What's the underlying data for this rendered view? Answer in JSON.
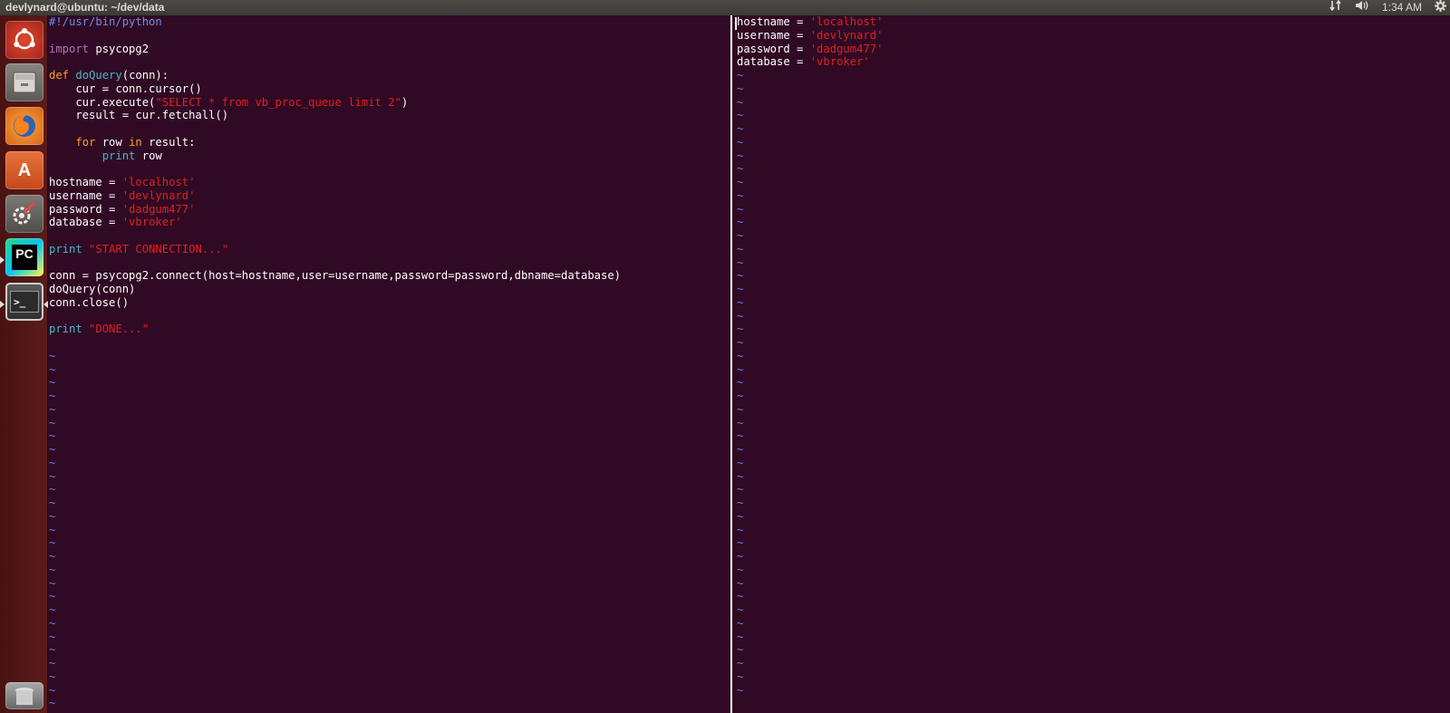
{
  "topbar": {
    "title": "devlynard@ubuntu: ~/dev/data",
    "time": "1:34 AM",
    "icons": [
      "network-icon",
      "volume-icon",
      "settings-gear-icon"
    ]
  },
  "launcher": {
    "items": [
      {
        "name": "ubuntu-dash",
        "label": ""
      },
      {
        "name": "files",
        "label": ""
      },
      {
        "name": "firefox",
        "label": ""
      },
      {
        "name": "software-center",
        "label": "A"
      },
      {
        "name": "system-settings",
        "label": ""
      },
      {
        "name": "pycharm",
        "label": "PC"
      },
      {
        "name": "terminal",
        "label": ">_"
      },
      {
        "name": "trash",
        "label": ""
      }
    ]
  },
  "editor_left": {
    "lines": [
      {
        "t": "comment",
        "text": "#!/usr/bin/python"
      },
      {
        "t": "plain",
        "text": ""
      },
      {
        "t": "import",
        "kw": "import",
        "rest": " psycopg2"
      },
      {
        "t": "plain",
        "text": ""
      },
      {
        "t": "def",
        "kw": "def",
        "fn": "doQuery",
        "rest": "(conn):"
      },
      {
        "t": "plain",
        "text": "    cur = conn.cursor()"
      },
      {
        "t": "strcall",
        "pre": "    cur.execute(",
        "str": "\"SELECT * from vb_proc_queue limit 2\"",
        "post": ")"
      },
      {
        "t": "plain",
        "text": "    result = cur.fetchall()"
      },
      {
        "t": "plain",
        "text": ""
      },
      {
        "t": "for",
        "pre": "    ",
        "kw": "for",
        "mid": " row ",
        "kw2": "in",
        "rest": " result:"
      },
      {
        "t": "printvar",
        "pre": "        ",
        "kw": "print",
        "rest": " row"
      },
      {
        "t": "plain",
        "text": ""
      },
      {
        "t": "assign",
        "name": "hostname",
        "str": "'localhost'"
      },
      {
        "t": "assign",
        "name": "username",
        "str": "'devlynard'"
      },
      {
        "t": "assign",
        "name": "password",
        "str": "'dadgum477'"
      },
      {
        "t": "assign",
        "name": "database",
        "str": "'vbroker'"
      },
      {
        "t": "plain",
        "text": ""
      },
      {
        "t": "printstr",
        "kw": "print",
        "str": "\"START CONNECTION...\""
      },
      {
        "t": "plain",
        "text": ""
      },
      {
        "t": "plain",
        "text": "conn = psycopg2.connect(host=hostname,user=username,password=password,dbname=database)"
      },
      {
        "t": "plain",
        "text": "doQuery(conn)"
      },
      {
        "t": "plain",
        "text": "conn.close()"
      },
      {
        "t": "plain",
        "text": ""
      },
      {
        "t": "printstr",
        "kw": "print",
        "str": "\"DONE...\""
      },
      {
        "t": "plain",
        "text": ""
      }
    ],
    "tilde_count": 27,
    "tilde_char": "~"
  },
  "editor_right": {
    "lines": [
      {
        "t": "assign",
        "name": "hostname",
        "str": "'localhost'"
      },
      {
        "t": "assign",
        "name": "username",
        "str": "'devlynard'"
      },
      {
        "t": "assign",
        "name": "password",
        "str": "'dadgum477'"
      },
      {
        "t": "assign",
        "name": "database",
        "str": "'vbroker'"
      }
    ],
    "tilde_count": 47,
    "tilde_char": "~"
  },
  "colors": {
    "background": "#300a24",
    "string": "#e02020",
    "keyword": "#ff9f1a",
    "function": "#43b7c8",
    "comment": "#6b8ee6",
    "tilde": "#6b7ee6"
  }
}
